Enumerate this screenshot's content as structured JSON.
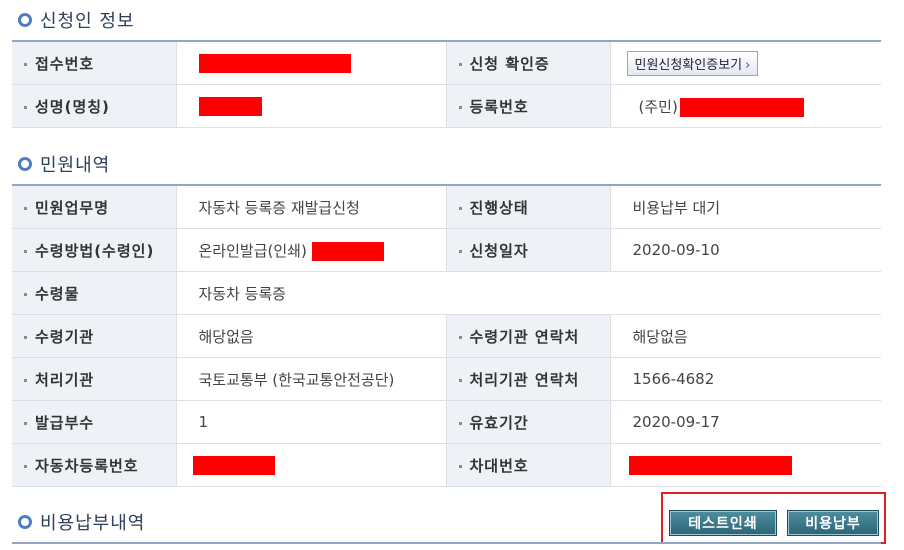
{
  "applicant": {
    "title": "신청인 정보",
    "rows": [
      {
        "label1": "접수번호",
        "value1": "",
        "label2": "신청 확인증",
        "value2": "민원신청확인증보기"
      },
      {
        "label1": "성명(명칭)",
        "value1": "",
        "label2": "등록번호",
        "value2": "(주민)"
      }
    ]
  },
  "petition": {
    "title": "민원내역",
    "rows": [
      {
        "label1": "민원업무명",
        "value1": "자동차 등록증 재발급신청",
        "label2": "진행상태",
        "value2": "비용납부 대기"
      },
      {
        "label1": "수령방법(수령인)",
        "value1": "온라인발급(인쇄)",
        "label2": "신청일자",
        "value2": "2020-09-10"
      },
      {
        "label1": "수령물",
        "value1": "자동차 등록증"
      },
      {
        "label1": "수령기관",
        "value1": "해당없음",
        "label2": "수령기관 연락처",
        "value2": "해당없음"
      },
      {
        "label1": "처리기관",
        "value1": "국토교통부 (한국교통안전공단)",
        "label2": "처리기관 연락처",
        "value2": "1566-4682"
      },
      {
        "label1": "발급부수",
        "value1": "1",
        "label2": "유효기간",
        "value2": "2020-09-17"
      },
      {
        "label1": "자동차등록번호",
        "value1": "",
        "label2": "차대번호",
        "value2": ""
      }
    ]
  },
  "payment": {
    "title": "비용납부내역",
    "test_print_label": "테스트인쇄",
    "pay_label": "비용납부"
  },
  "colors": {
    "accent": "#4a7fc1",
    "redaction": "#ff0000",
    "button": "#2c6577",
    "highlight": "#e02020"
  },
  "icons": {
    "section": "circle-bullet-icon",
    "view_arrow": "chevron-right-icon"
  }
}
